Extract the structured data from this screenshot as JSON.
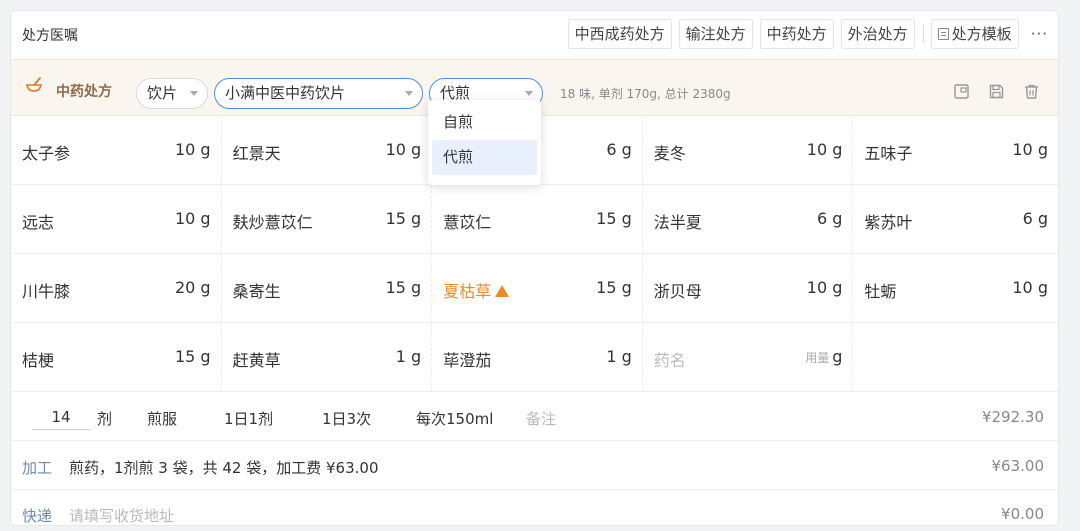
{
  "header": {
    "title": "处方医嘱",
    "tabs": [
      "中西成药处方",
      "输注处方",
      "中药处方",
      "外治处方"
    ],
    "template_label": "处方模板",
    "more": "···"
  },
  "toolbar": {
    "title": "中药处方",
    "form": "饮片",
    "pharmacy": "小满中医中药饮片",
    "decoction": "代煎",
    "summary": "18 味, 单剂 170g, 总计 2380g"
  },
  "dropdown": {
    "options": [
      "自煎",
      "代煎"
    ],
    "selected": "代煎"
  },
  "herbs": [
    [
      {
        "name": "太子参",
        "dose": "10 g"
      },
      {
        "name": "红景天",
        "dose": "10 g"
      },
      {
        "name": "",
        "dose": "6 g"
      },
      {
        "name": "麦冬",
        "dose": "10 g"
      },
      {
        "name": "五味子",
        "dose": "10 g"
      }
    ],
    [
      {
        "name": "远志",
        "dose": "10 g"
      },
      {
        "name": "麸炒薏苡仁",
        "dose": "15 g"
      },
      {
        "name": "薏苡仁",
        "dose": "15 g"
      },
      {
        "name": "法半夏",
        "dose": "6 g"
      },
      {
        "name": "紫苏叶",
        "dose": "6 g"
      }
    ],
    [
      {
        "name": "川牛膝",
        "dose": "20 g"
      },
      {
        "name": "桑寄生",
        "dose": "15 g"
      },
      {
        "name": "夏枯草",
        "dose": "15 g"
      },
      {
        "name": "浙贝母",
        "dose": "10 g"
      },
      {
        "name": "牡蛎",
        "dose": "10 g"
      }
    ],
    [
      {
        "name": "桔梗",
        "dose": "15 g"
      },
      {
        "name": "赶黄草",
        "dose": "1 g"
      },
      {
        "name": "荜澄茄",
        "dose": "1 g"
      },
      {
        "name": "药名",
        "dose": "g",
        "dose_ph": "用量"
      },
      {
        "name": "",
        "dose": ""
      }
    ]
  ],
  "usage": {
    "qty": "14",
    "unit": "剂",
    "method": "煎服",
    "freq1": "1日1剂",
    "freq2": "1日3次",
    "each": "每次150ml",
    "note_ph": "备注",
    "price": "¥292.30"
  },
  "processing": {
    "label": "加工",
    "text": "煎药，1剂煎 3 袋，共 42 袋，加工费 ¥63.00",
    "amount": "¥63.00"
  },
  "delivery": {
    "label": "快递",
    "placeholder": "请填写收货地址",
    "amount": "¥0.00"
  },
  "colors": {
    "warning": "#f08a24",
    "accent": "#4a8cf0",
    "toolbar_bg": "#fbf5ef"
  }
}
